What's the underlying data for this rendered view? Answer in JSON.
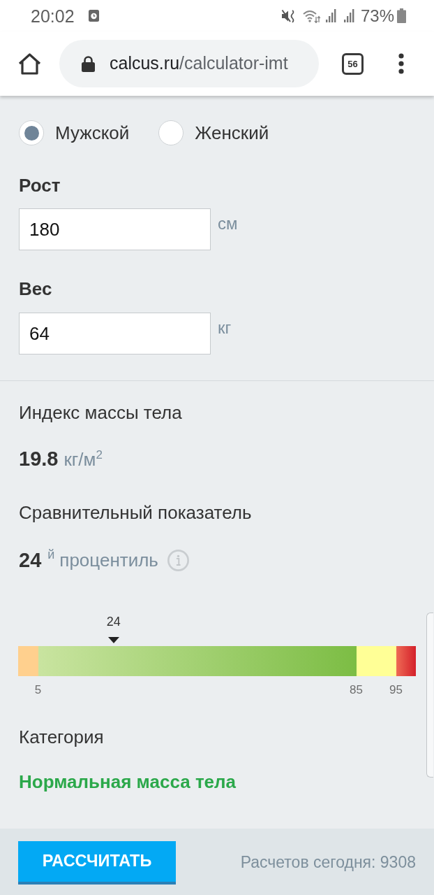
{
  "status_bar": {
    "time": "20:02",
    "battery": "73%"
  },
  "browser": {
    "url_host": "calcus.ru",
    "url_path": "/calculator-imt",
    "tab_count": "56"
  },
  "form": {
    "gender": {
      "options": [
        {
          "label": "Мужской",
          "selected": true
        },
        {
          "label": "Женский",
          "selected": false
        }
      ]
    },
    "fields": [
      {
        "label": "Рост",
        "value": "180",
        "unit": "см"
      },
      {
        "label": "Вес",
        "value": "64",
        "unit": "кг"
      }
    ]
  },
  "result": {
    "bmi_label": "Индекс массы тела",
    "bmi_value": "19.8",
    "bmi_unit": "кг/м$^{2}$",
    "percentile_label": "Сравнительный показатель",
    "percentile_value": "24",
    "percentile_suffix": "й",
    "percentile_unit": "процентиль",
    "scale": {
      "marker_label": "24",
      "level": 0.24,
      "segments": [
        {
          "kind": "low",
          "end_label": "5"
        },
        {
          "kind": "normal",
          "end_label": "85"
        },
        {
          "kind": "high",
          "end_label": "95"
        },
        {
          "kind": "very_high"
        }
      ]
    },
    "category_label": "Категория",
    "category": "Нормальная масса тела"
  },
  "footer": {
    "button": "РАССЧИТАТЬ",
    "counter": "Расчетов сегодня: 9308"
  }
}
